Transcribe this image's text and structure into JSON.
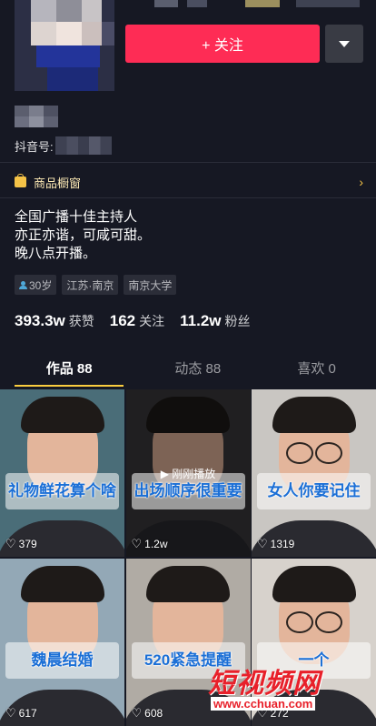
{
  "header": {
    "follow_label": "+ 关注",
    "douyin_id_label": "抖音号:"
  },
  "shop": {
    "label": "商品橱窗",
    "chevron": "›"
  },
  "bio": [
    "全国广播十佳主持人",
    "亦正亦谐，可咸可甜。",
    "晚八点开播。"
  ],
  "tags": [
    {
      "label": "30岁",
      "icon": "person-icon"
    },
    {
      "label": "江苏·南京"
    },
    {
      "label": "南京大学"
    }
  ],
  "stats": [
    {
      "value": "393.3w",
      "label": "获赞"
    },
    {
      "value": "162",
      "label": "关注"
    },
    {
      "value": "11.2w",
      "label": "粉丝"
    }
  ],
  "tabs": [
    {
      "label": "作品 88",
      "active": true
    },
    {
      "label": "动态 88",
      "active": false
    },
    {
      "label": "喜欢 0",
      "active": false
    }
  ],
  "videos": [
    {
      "caption": "礼物鲜花算个啥",
      "likes": "379",
      "bg": "#4a6d78"
    },
    {
      "caption": "出场顺序很重要",
      "likes": "1.2w",
      "bg": "#3b3a3c",
      "played": "▶ 刚刚播放"
    },
    {
      "caption": "女人你要记住",
      "likes": "1319",
      "bg": "#c9c6c2",
      "glasses": true
    },
    {
      "caption": "魏晨结婚",
      "likes": "617",
      "bg": "#93a8b6"
    },
    {
      "caption": "520紧急提醒",
      "likes": "608",
      "bg": "#b0aba4"
    },
    {
      "caption": "一个",
      "likes": "272",
      "bg": "#d7d2cc",
      "glasses": true
    }
  ],
  "watermark": {
    "text": "短视频网",
    "url": "www.cchuan.com"
  },
  "colors": {
    "accent": "#fe2c55",
    "tab_indicator": "#facd3f",
    "background": "#161823"
  }
}
